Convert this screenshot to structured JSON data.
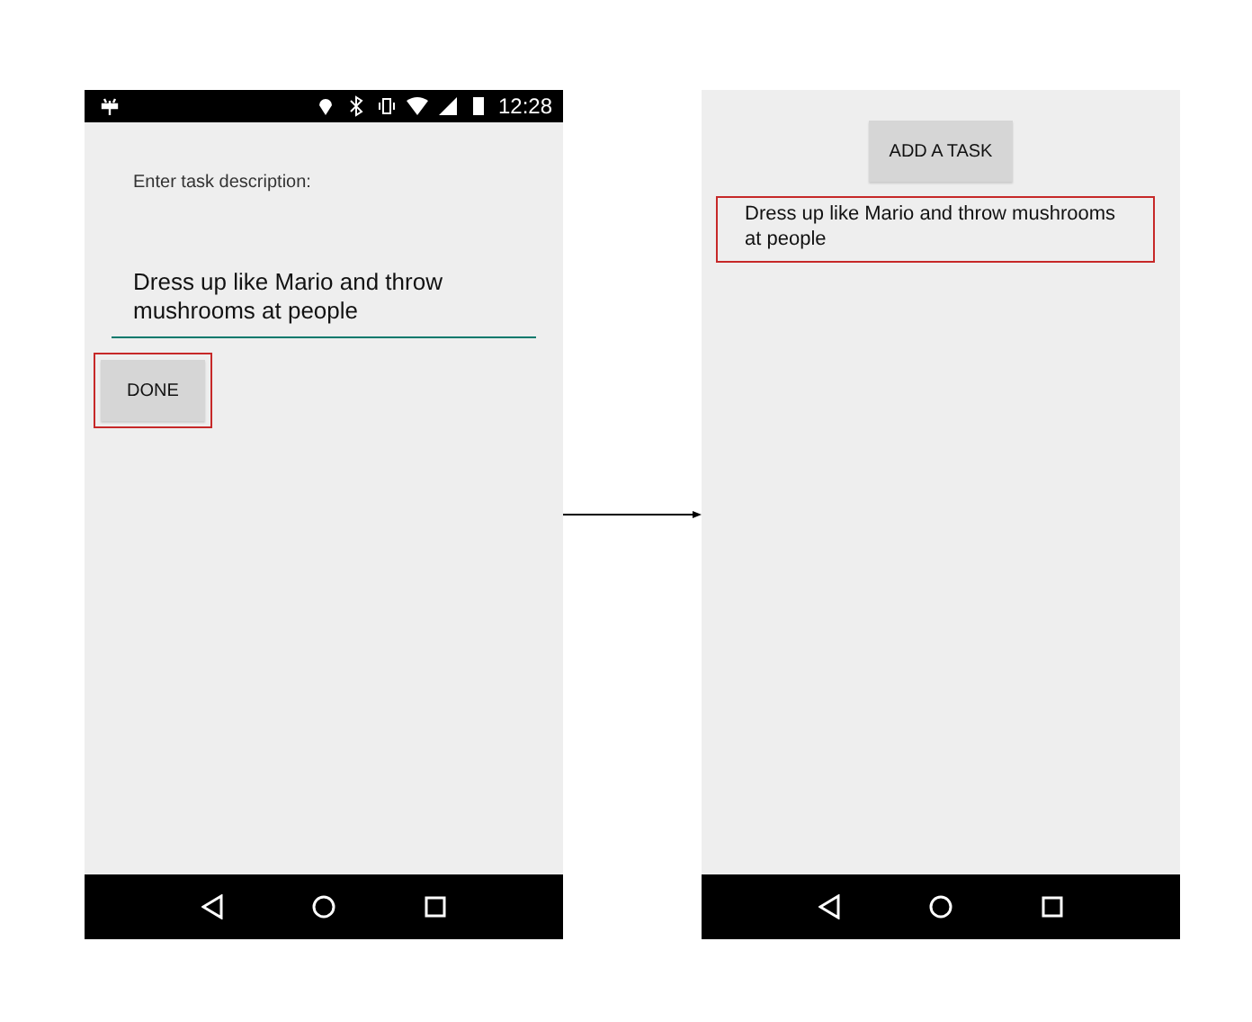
{
  "screens": [
    {
      "kind": "edit",
      "status_bar": {
        "time": "12:28"
      },
      "prompt": "Enter task description:",
      "field": {
        "value": "Dress up like Mario and throw mushrooms at people"
      },
      "button": {
        "label": "DONE",
        "highlighted": true
      }
    },
    {
      "kind": "list",
      "button": {
        "label": "ADD A TASK"
      },
      "tasks": [
        {
          "text": "Dress up like Mario and throw mushrooms at people",
          "highlighted": true
        }
      ]
    }
  ]
}
